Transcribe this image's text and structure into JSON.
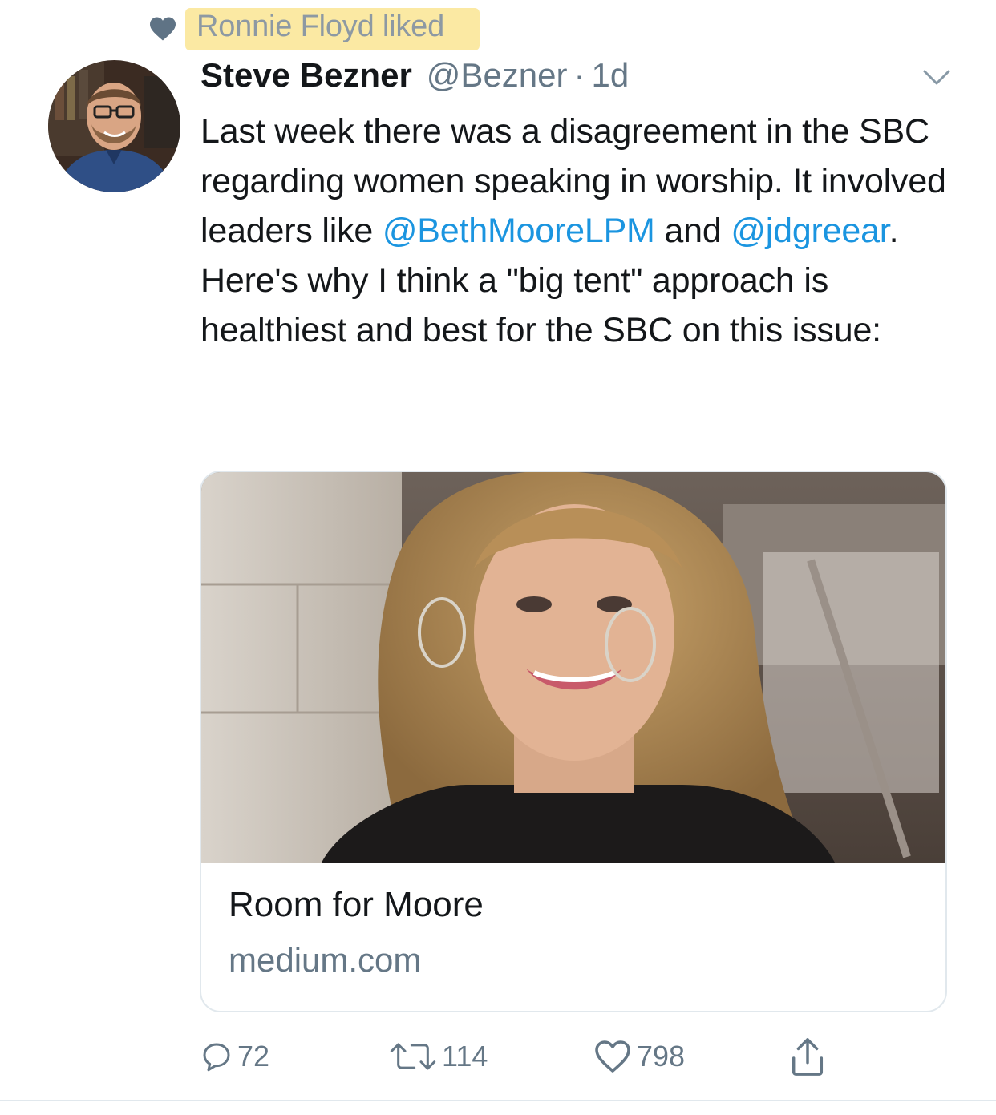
{
  "social_context": {
    "text": "Ronnie Floyd liked",
    "icon": "heart-icon"
  },
  "tweet": {
    "author_name": "Steve Bezner",
    "handle": "@Bezner",
    "separator": "·",
    "time": "1d",
    "text_parts": [
      "Last week there was a disagreement in the SBC regarding women speaking in worship. It involved leaders like ",
      "@BethMooreLPM",
      " and ",
      "@jdgreear",
      ". Here's why I think a \"big tent\" approach is healthiest and best for the SBC on this issue:"
    ]
  },
  "card": {
    "title": "Room for Moore",
    "domain": "medium.com"
  },
  "actions": {
    "replies": "72",
    "retweets": "114",
    "likes": "798"
  },
  "colors": {
    "accent": "#1b95e0",
    "muted": "#657786",
    "highlight": "#fbe9a3",
    "heart": "#5f7385"
  }
}
